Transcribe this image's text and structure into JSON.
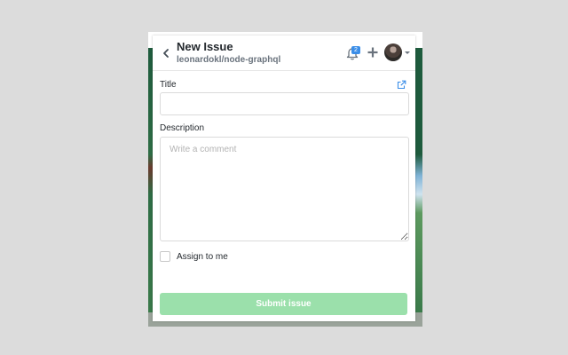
{
  "header": {
    "title": "New Issue",
    "repo": "leonardokl/node-graphql",
    "notification_count": "2"
  },
  "form": {
    "title_label": "Title",
    "title_value": "",
    "description_label": "Description",
    "description_placeholder": "Write a comment",
    "assign_label": "Assign to me",
    "assign_checked": false,
    "submit_label": "Submit issue"
  },
  "icons": {
    "back": "chevron-left-icon",
    "notifications": "bell-icon",
    "add": "plus-icon",
    "external": "external-link-icon"
  },
  "colors": {
    "submit_button": "#9be0ab",
    "badge": "#3b8ee8",
    "link_icon": "#3b8ee8"
  }
}
